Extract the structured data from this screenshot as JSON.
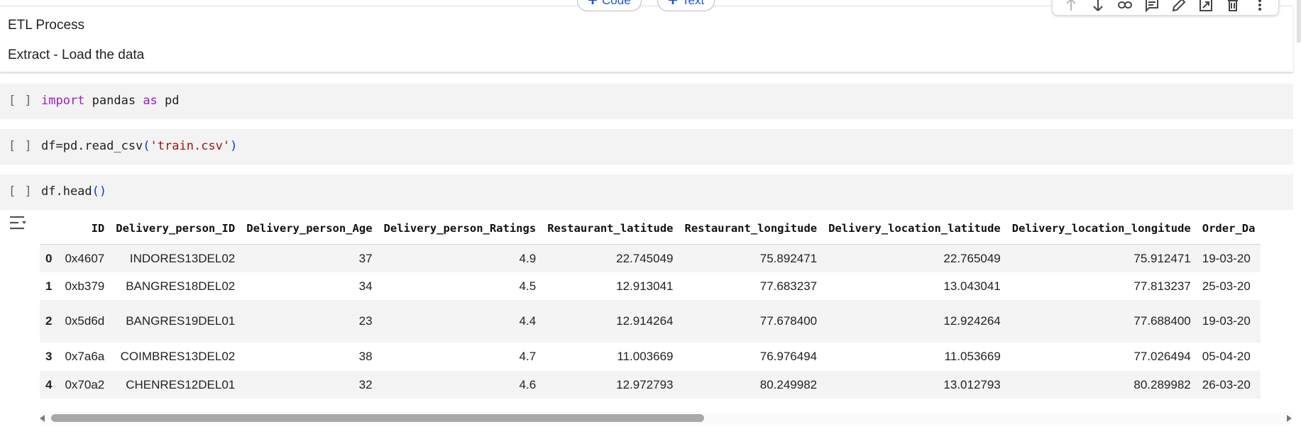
{
  "markdown_cell": {
    "title": "ETL Process",
    "subtitle": "Extract - Load the data"
  },
  "add_buttons": {
    "code_label": "Code",
    "text_label": "Text"
  },
  "toolbar": {
    "icons": [
      "arrow-up-icon",
      "arrow-down-icon",
      "link-icon",
      "comment-icon",
      "edit-icon",
      "mirror-cell-icon",
      "delete-icon",
      "more-vert-icon"
    ]
  },
  "cells": [
    {
      "bracket": "[ ]",
      "tokens": [
        {
          "t": "import",
          "c": "kw"
        },
        {
          "t": " pandas ",
          "c": ""
        },
        {
          "t": "as",
          "c": "kw"
        },
        {
          "t": " pd",
          "c": ""
        }
      ]
    },
    {
      "bracket": "[ ]",
      "tokens": [
        {
          "t": "df=pd.read_csv",
          "c": ""
        },
        {
          "t": "(",
          "c": "paren"
        },
        {
          "t": "'train.csv'",
          "c": "str"
        },
        {
          "t": ")",
          "c": "paren"
        }
      ]
    },
    {
      "bracket": "[ ]",
      "tokens": [
        {
          "t": "df.head",
          "c": ""
        },
        {
          "t": "()",
          "c": "paren"
        }
      ]
    }
  ],
  "output_table": {
    "columns": [
      "",
      "ID",
      "Delivery_person_ID",
      "Delivery_person_Age",
      "Delivery_person_Ratings",
      "Restaurant_latitude",
      "Restaurant_longitude",
      "Delivery_location_latitude",
      "Delivery_location_longitude",
      "Order_Da"
    ],
    "rows": [
      [
        "0",
        "0x4607",
        "INDORES13DEL02",
        "37",
        "4.9",
        "22.745049",
        "75.892471",
        "22.765049",
        "75.912471",
        "19-03-20"
      ],
      [
        "1",
        "0xb379",
        "BANGRES18DEL02",
        "34",
        "4.5",
        "12.913041",
        "77.683237",
        "13.043041",
        "77.813237",
        "25-03-20"
      ],
      [
        "2",
        "0x5d6d",
        "BANGRES19DEL01",
        "23",
        "4.4",
        "12.914264",
        "77.678400",
        "12.924264",
        "77.688400",
        "19-03-20"
      ],
      [
        "3",
        "0x7a6a",
        "COIMBRES13DEL02",
        "38",
        "4.7",
        "11.003669",
        "76.976494",
        "11.053669",
        "77.026494",
        "05-04-20"
      ],
      [
        "4",
        "0x70a2",
        "CHENRES12DEL01",
        "32",
        "4.6",
        "12.972793",
        "80.249982",
        "13.012793",
        "80.289982",
        "26-03-20"
      ]
    ]
  },
  "colors": {
    "keyword": "#9b1ec4",
    "string": "#a31515",
    "paren": "#0c3bd1",
    "button_text": "#1a57c9"
  }
}
